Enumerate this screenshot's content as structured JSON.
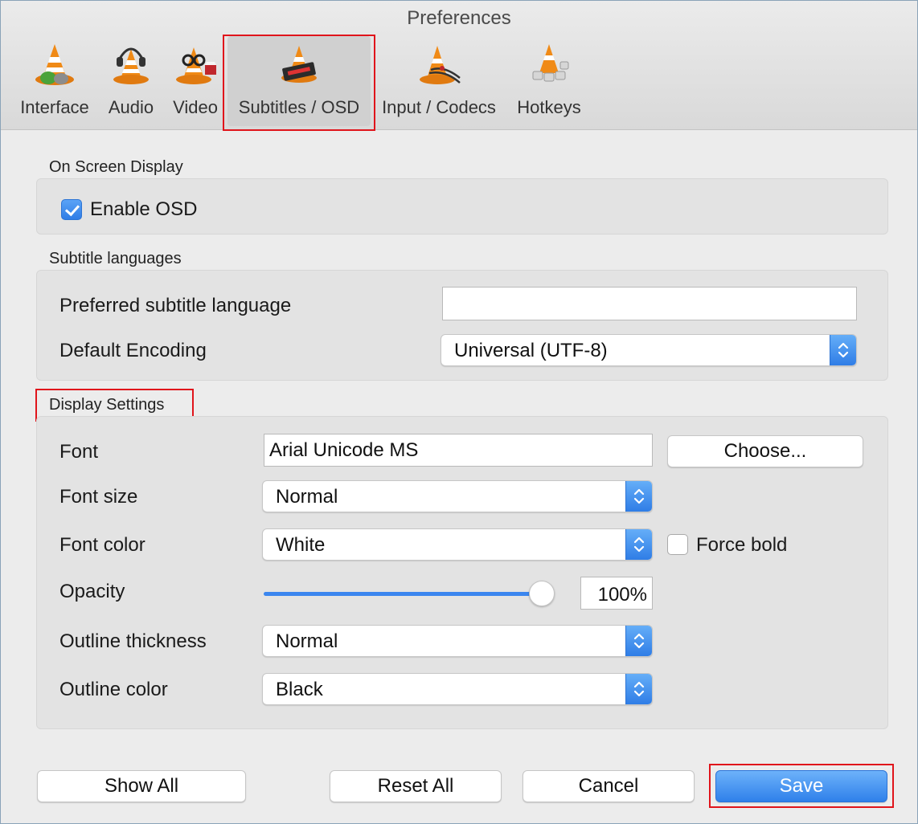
{
  "window": {
    "title": "Preferences"
  },
  "tabs": [
    {
      "label": "Interface",
      "icon": "vlc-cone-interface-icon",
      "selected": false
    },
    {
      "label": "Audio",
      "icon": "vlc-cone-headphones-icon",
      "selected": false
    },
    {
      "label": "Video",
      "icon": "vlc-cone-glasses-icon",
      "selected": false
    },
    {
      "label": "Subtitles / OSD",
      "icon": "vlc-cone-subtitles-icon",
      "selected": true
    },
    {
      "label": "Input / Codecs",
      "icon": "vlc-cone-cables-icon",
      "selected": false
    },
    {
      "label": "Hotkeys",
      "icon": "vlc-cone-keys-icon",
      "selected": false
    }
  ],
  "osd": {
    "section_title": "On Screen Display",
    "enable_osd_label": "Enable OSD",
    "enable_osd_checked": true
  },
  "subtitle_languages": {
    "section_title": "Subtitle languages",
    "preferred_label": "Preferred subtitle language",
    "preferred_value": "",
    "encoding_label": "Default Encoding",
    "encoding_value": "Universal (UTF-8)"
  },
  "display_settings": {
    "section_title": "Display Settings",
    "font_label": "Font",
    "font_value": "Arial Unicode MS",
    "choose_button": "Choose...",
    "font_size_label": "Font size",
    "font_size_value": "Normal",
    "font_color_label": "Font color",
    "font_color_value": "White",
    "force_bold_label": "Force bold",
    "force_bold_checked": false,
    "opacity_label": "Opacity",
    "opacity_value": "100%",
    "opacity_fraction": 1.0,
    "outline_thickness_label": "Outline thickness",
    "outline_thickness_value": "Normal",
    "outline_color_label": "Outline color",
    "outline_color_value": "Black"
  },
  "buttons": {
    "show_all": "Show All",
    "reset_all": "Reset All",
    "cancel": "Cancel",
    "save": "Save"
  },
  "colors": {
    "accent": "#2f80ea",
    "highlight_box": "#e0141b",
    "vlc_orange": "#f08a16"
  }
}
